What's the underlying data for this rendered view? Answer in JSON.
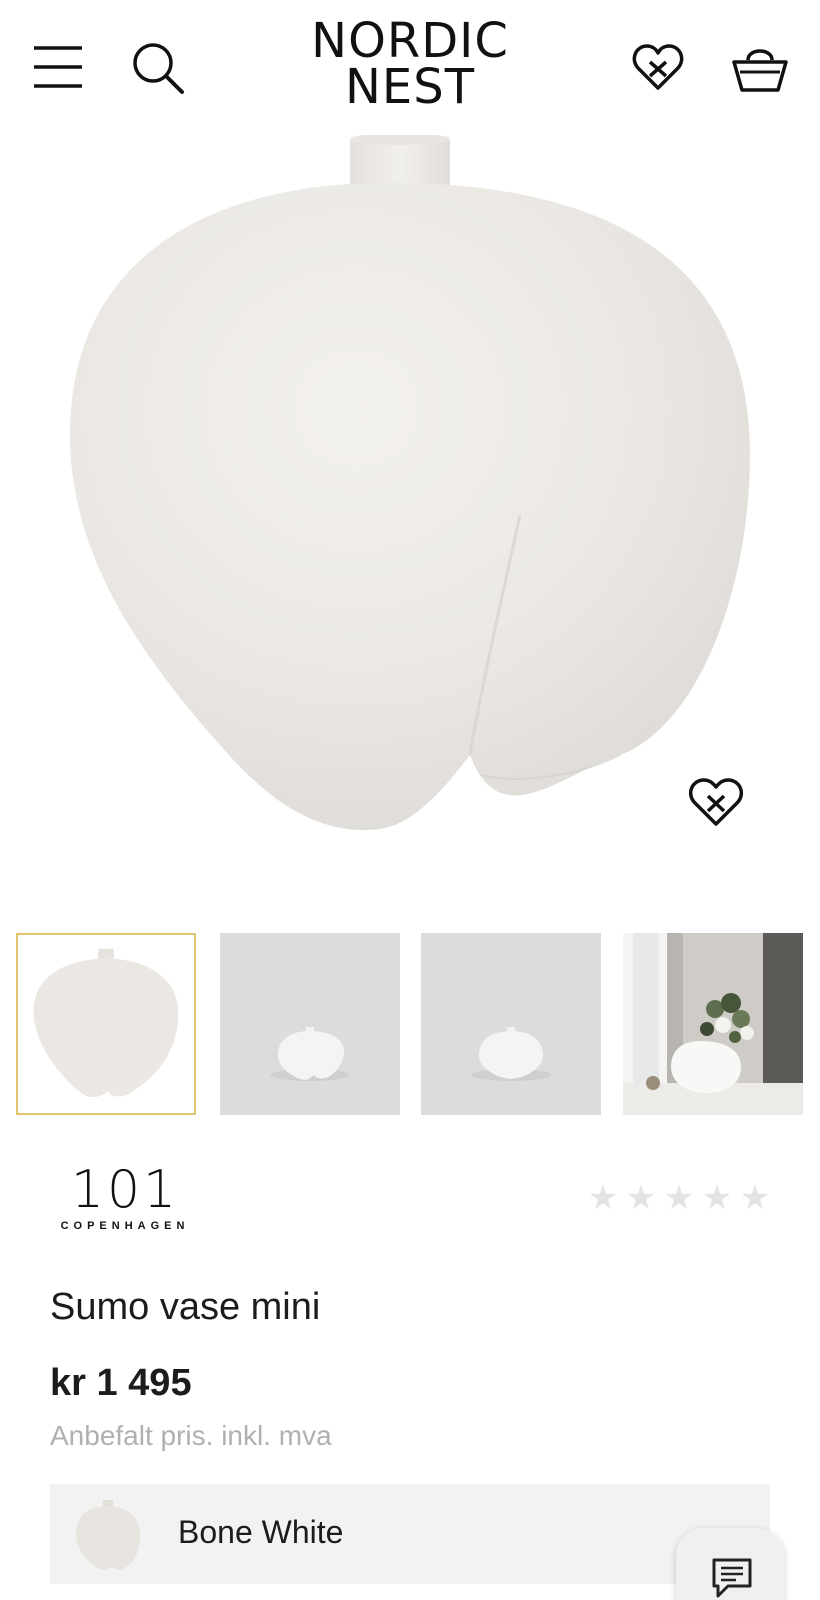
{
  "header": {
    "logo_line1": "NORDIC",
    "logo_line2": "NEST",
    "icons": [
      "menu-icon",
      "search-icon",
      "wishlist-heart-icon",
      "cart-basket-icon"
    ]
  },
  "product": {
    "brand_number": "101",
    "brand_city": "COPENHAGEN",
    "title": "Sumo vase mini",
    "price": "kr 1 495",
    "price_note": "Anbefalt pris. inkl. mva",
    "rating_stars": [
      "★",
      "★",
      "★",
      "★",
      "★"
    ],
    "rating_value": 0
  },
  "gallery": {
    "active_index": 0,
    "thumbnail_count": 4
  },
  "variant": {
    "label": "Bone White"
  },
  "colors": {
    "accent_border": "#e2c36e",
    "text": "#1c1c1c",
    "muted": "#b0b0b0",
    "variant_bg": "#f2f2f2",
    "star_empty": "#e4e4e4"
  }
}
